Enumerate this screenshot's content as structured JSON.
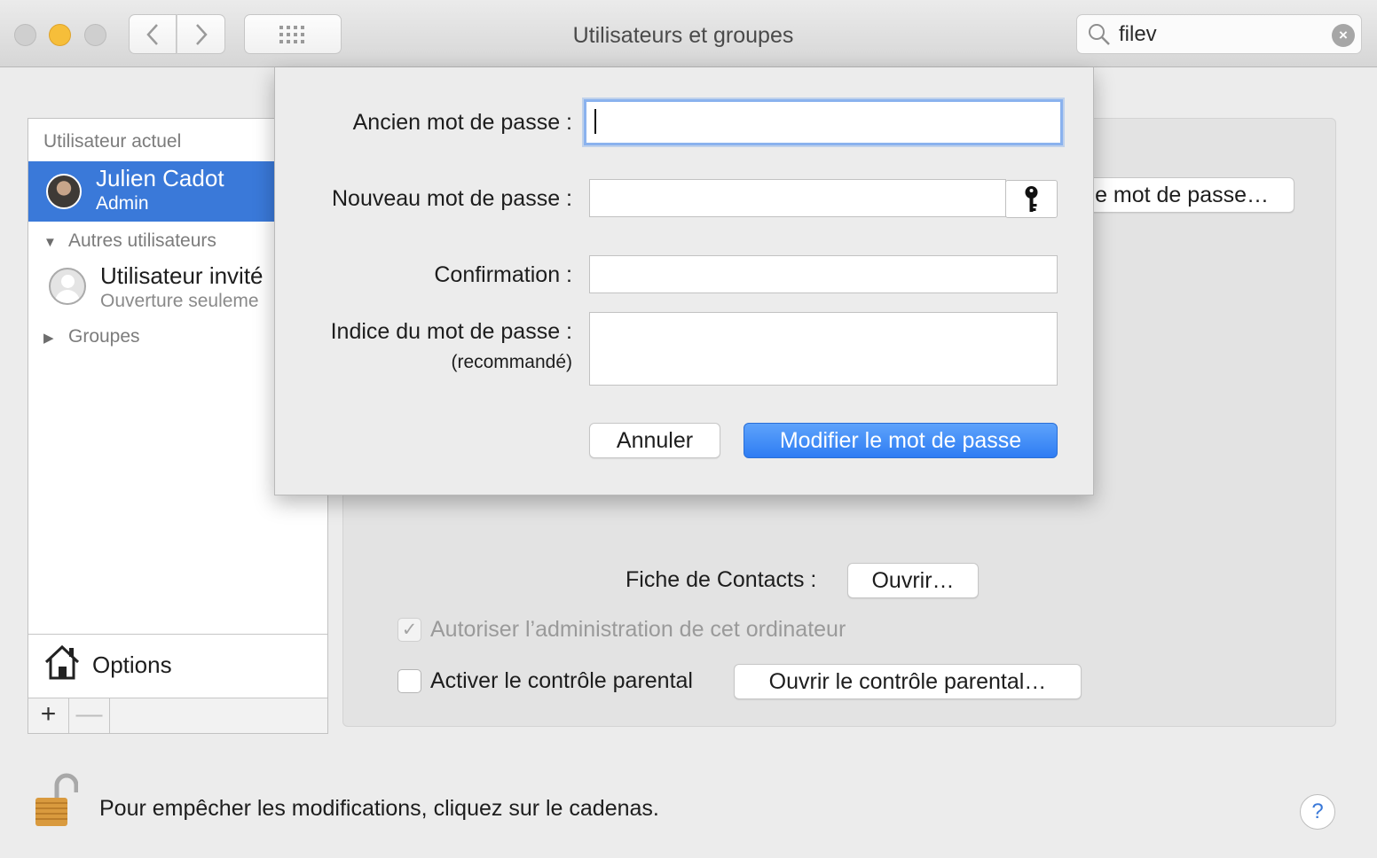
{
  "window": {
    "title": "Utilisateurs et groupes",
    "search_value": "filev"
  },
  "sidebar": {
    "current_header": "Utilisateur actuel",
    "current_user": {
      "name": "Julien Cadot",
      "role": "Admin"
    },
    "other_users_header": "Autres utilisateurs",
    "guest": {
      "name": "Utilisateur invité",
      "subtitle": "Ouverture seuleme"
    },
    "groups_header": "Groupes",
    "options_label": "Options",
    "add_symbol": "+",
    "remove_symbol": "—"
  },
  "panel": {
    "change_password_button": "e mot de passe…",
    "contacts_label": "Fiche de Contacts :",
    "contacts_open_button": "Ouvrir…",
    "allow_admin_label": "Autoriser l’administration de cet ordinateur",
    "allow_admin_check": "✓",
    "parental_label": "Activer le contrôle parental",
    "parental_button": "Ouvrir le contrôle parental…"
  },
  "sheet": {
    "old_password_label": "Ancien mot de passe :",
    "new_password_label": "Nouveau mot de passe :",
    "confirm_label": "Confirmation :",
    "hint_label": "Indice du mot de passe :",
    "hint_note": "(recommandé)",
    "cancel_button": "Annuler",
    "submit_button": "Modifier le mot de passe"
  },
  "footer": {
    "lock_text": "Pour empêcher les modifications, cliquez sur le cadenas.",
    "help_symbol": "?"
  },
  "colors": {
    "selection": "#3a79d9",
    "primary_button": "#2e7cf3",
    "minimize_light": "#f6be3a"
  }
}
